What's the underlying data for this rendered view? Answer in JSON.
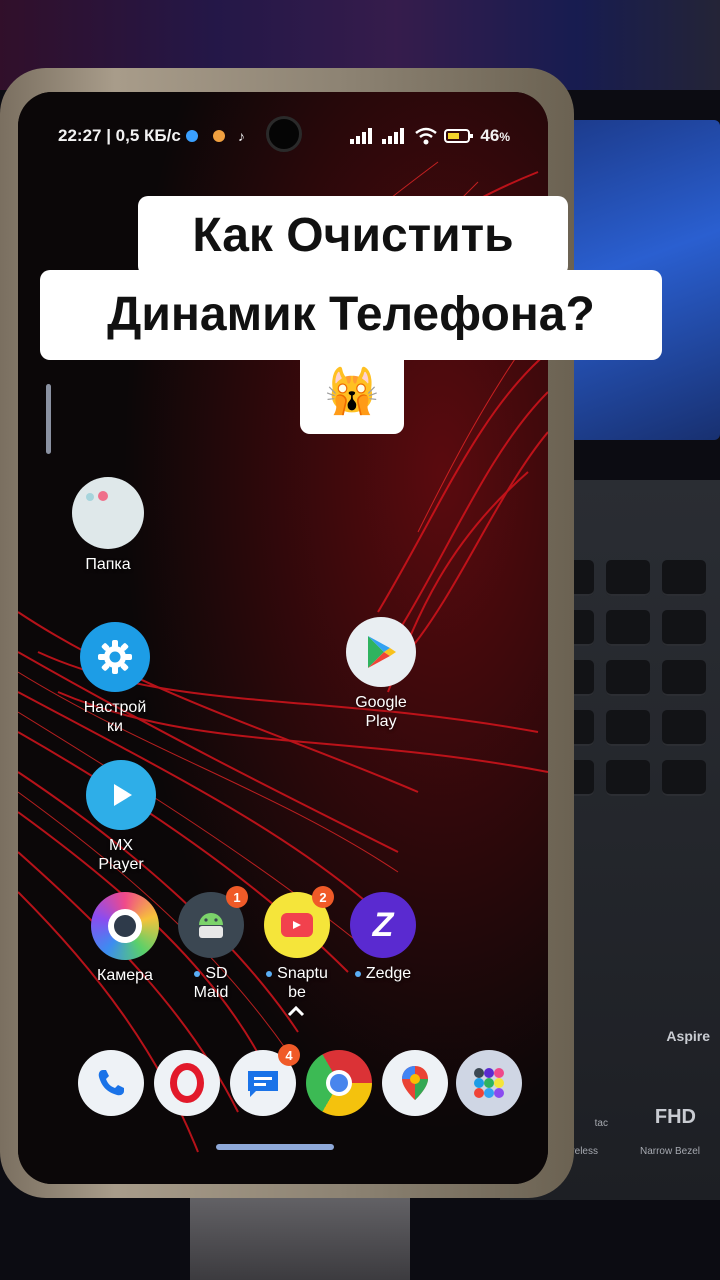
{
  "status_bar": {
    "time_speed": "22:27 | 0,5 КБ/с",
    "battery": "46"
  },
  "caption": {
    "line1": "Как Очистить",
    "line2": "Динамик Телефона?",
    "emoji": "🙀"
  },
  "apps": {
    "folder": "Папка",
    "settings": "Настрой\nки",
    "google_play": "Google\nPlay",
    "mx_player": "MX\nPlayer",
    "camera": "Камера",
    "sd_maid": "SD\nMaid",
    "sd_maid_badge": "1",
    "snaptube": "Snaptu\nbe",
    "snaptube_badge": "2",
    "zedge": "Zedge",
    "messages_badge": "4"
  },
  "laptop": {
    "brand": "Aspire",
    "fhd": "FHD",
    "wireless": "Wireless",
    "narrow_bezel": "Narrow Bezel",
    "tac": "tac"
  },
  "colors": {
    "accent_badge": "#f05a28",
    "caption_bg": "#ffffff",
    "wallpaper_red": "#d4141c"
  }
}
